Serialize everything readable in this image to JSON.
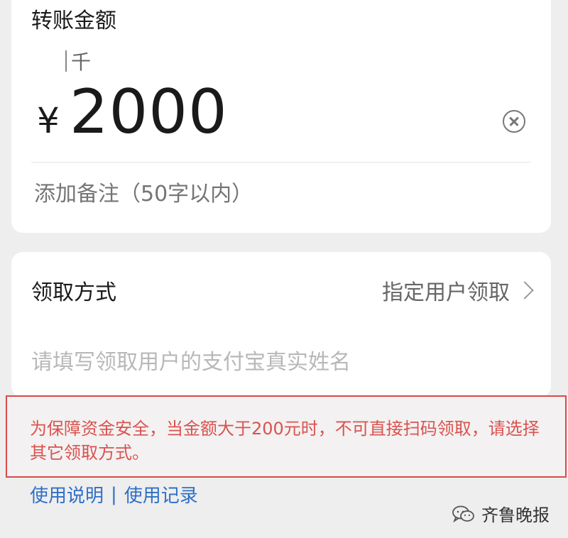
{
  "amount_section": {
    "title": "转账金额",
    "unit_hint": "千",
    "currency_symbol": "¥",
    "amount": "2000",
    "clear_icon": "clear-circle-icon",
    "remark_placeholder": "添加备注（50字以内）"
  },
  "method_section": {
    "label": "领取方式",
    "value": "指定用户领取",
    "chevron_icon": "chevron-right-icon",
    "name_placeholder": "请填写领取用户的支付宝真实姓名"
  },
  "notice": {
    "text": "为保障资金安全，当金额大于200元时，不可直接扫码领取，请选择其它领取方式。",
    "color": "#d9534f",
    "border_color": "#d94a4a"
  },
  "footer": {
    "link_instructions": "使用说明",
    "separator": "|",
    "link_records": "使用记录",
    "link_color": "#2e6fc7"
  },
  "watermark": {
    "icon": "wechat-icon",
    "text": "齐鲁晚报"
  }
}
